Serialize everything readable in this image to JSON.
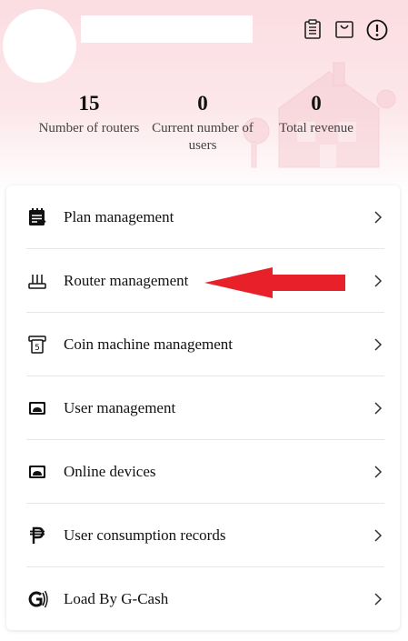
{
  "header": {
    "icons": [
      "clipboard-icon",
      "shopping-bag-icon",
      "alert-icon"
    ]
  },
  "stats": [
    {
      "value": "15",
      "label": "Number of routers"
    },
    {
      "value": "0",
      "label": "Current number of users"
    },
    {
      "value": "0",
      "label": "Total revenue"
    }
  ],
  "menu": {
    "items": [
      {
        "label": "Plan management",
        "icon": "plan-icon"
      },
      {
        "label": "Router management",
        "icon": "router-icon"
      },
      {
        "label": "Coin machine management",
        "icon": "coin-machine-icon"
      },
      {
        "label": "User management",
        "icon": "user-management-icon"
      },
      {
        "label": "Online devices",
        "icon": "online-devices-icon"
      },
      {
        "label": "User consumption records",
        "icon": "peso-icon"
      },
      {
        "label": "Load By G-Cash",
        "icon": "gcash-icon"
      }
    ]
  },
  "colors": {
    "header_gradient_top": "#fbdde2",
    "annotation_arrow": "#e8202a"
  }
}
